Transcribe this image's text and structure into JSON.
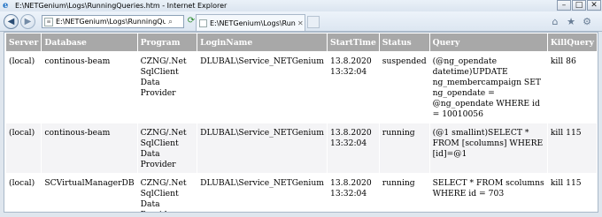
{
  "window": {
    "title": "E:\\NETGenium\\Logs\\RunningQueries.htm - Internet Explorer",
    "minimize": "–",
    "maximize": "□",
    "close": "✕"
  },
  "navbar": {
    "address": "E:\\NETGenium\\Logs\\RunningQueries",
    "search_glyph": "⌕",
    "tab_title": "E:\\NETGenium\\Logs\\Running...",
    "tab_close": "✕"
  },
  "icons": {
    "back": "back-arrow-icon",
    "forward": "forward-arrow-icon",
    "refresh": "refresh-icon",
    "home": "home-icon",
    "favorites": "star-icon",
    "tools": "gear-icon"
  },
  "table": {
    "headers": [
      "Server",
      "Database",
      "Program",
      "LoginName",
      "StartTime",
      "Status",
      "Query",
      "KillQuery"
    ],
    "rows": [
      {
        "server": "(local)",
        "database": "continous-beam",
        "program": "CZNG/.Net SqlClient Data Provider",
        "login": "DLUBAL\\Service_NETGenium",
        "start_date": "13.8.2020",
        "start_time": "13:32:04",
        "status": "suspended",
        "query": "(@ng_opendate datetime)UPDATE ng_membercampaign SET ng_opendate = @ng_opendate WHERE id = 10010056",
        "kill": "kill 86"
      },
      {
        "server": "(local)",
        "database": "continous-beam",
        "program": "CZNG/.Net SqlClient Data Provider",
        "login": "DLUBAL\\Service_NETGenium",
        "start_date": "13.8.2020",
        "start_time": "13:32:04",
        "status": "running",
        "query": "(@1 smallint)SELECT * FROM [scolumns] WHERE [id]=@1",
        "kill": "kill 115"
      },
      {
        "server": "(local)",
        "database": "SCVirtualManagerDB",
        "program": "CZNG/.Net SqlClient Data Provider",
        "login": "DLUBAL\\Service_NETGenium",
        "start_date": "13.8.2020",
        "start_time": "13:32:04",
        "status": "running",
        "query": "SELECT * FROM scolumns WHERE id = 703",
        "kill": "kill 115"
      }
    ]
  }
}
